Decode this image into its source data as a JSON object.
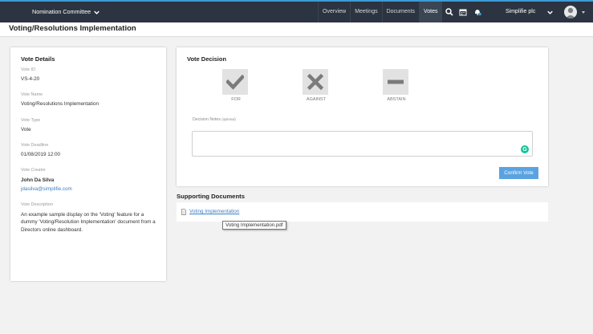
{
  "nav": {
    "committee": "Nomination Committee",
    "links": [
      "Overview",
      "Meetings",
      "Documents",
      "Votes"
    ],
    "org": "Simplifie plc",
    "icons": [
      "search-icon",
      "calendar-icon",
      "notification-bell-icon"
    ]
  },
  "page": {
    "title": "Voting/Resolutions Implementation"
  },
  "details": {
    "heading": "Vote Details",
    "vote_id_label": "Vote ID",
    "vote_id": "VS-4-20",
    "vote_name_label": "Vote Name",
    "vote_name": "Voting/Resolutions Implementation",
    "vote_type_label": "Vote Type",
    "vote_type": "Vote",
    "deadline_label": "Vote Deadline",
    "deadline": "01/08/2019 12:00",
    "creator_label": "Vote Creator",
    "creator_name": "John Da Silva",
    "creator_email": "jdasilva@simplifie.com",
    "description_label": "Vote Description",
    "description": "An example sample display on the 'Voting' feature for a dummy 'Voting/Resolution Implementation' document from a Directors online dashboard."
  },
  "decision": {
    "heading": "Vote Decision",
    "options": [
      {
        "label": "FOR",
        "icon": "check-icon"
      },
      {
        "label": "AGAINST",
        "icon": "x-icon"
      },
      {
        "label": "ABSTAIN",
        "icon": "minus-icon"
      }
    ],
    "notes_label": "Decision Notes",
    "notes_optional": "(optional)",
    "notes_value": "",
    "confirm_label": "Confirm Vote"
  },
  "supporting": {
    "heading": "Supporting Documents",
    "doc_name": "Voting Implementation",
    "tooltip": "Voting Implementation.pdf"
  },
  "colors": {
    "nav_bg": "#2b3440",
    "accent": "#3d9bd6",
    "button": "#5aa3e0",
    "link": "#3b7fc4"
  }
}
